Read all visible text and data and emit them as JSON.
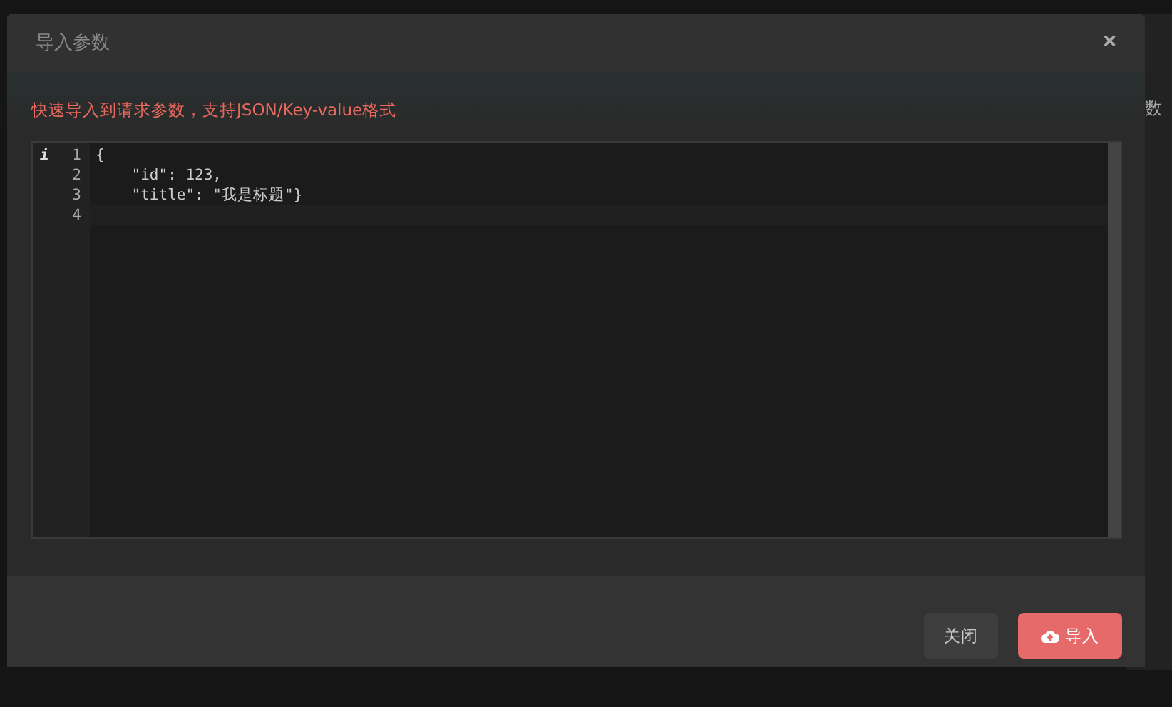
{
  "background": {
    "label": "数"
  },
  "dialog": {
    "title": "导入参数",
    "close": "×",
    "hint": "快速导入到请求参数，支持JSON/Key-value格式",
    "editor": {
      "info_marker": "i",
      "lines": [
        {
          "number": "1",
          "text": "{"
        },
        {
          "number": "2",
          "text": "    \"id\": 123,"
        },
        {
          "number": "3",
          "text": "    \"title\": \"我是标题\"}"
        },
        {
          "number": "4"
        }
      ]
    },
    "buttons": [
      {
        "kind": "secondary",
        "label": "关闭"
      },
      {
        "kind": "primary",
        "label": "导入"
      }
    ]
  }
}
